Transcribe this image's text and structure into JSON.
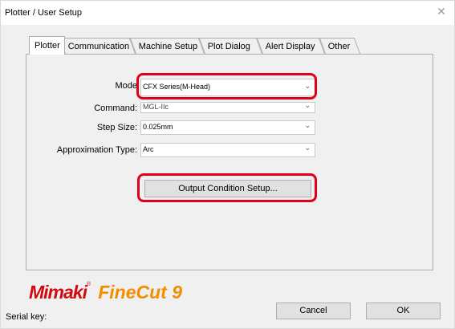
{
  "window": {
    "title": "Plotter / User Setup",
    "close_glyph": "✕"
  },
  "tabs": [
    {
      "label": "Plotter",
      "active": true
    },
    {
      "label": "Communication"
    },
    {
      "label": "Machine Setup"
    },
    {
      "label": "Plot Dialog"
    },
    {
      "label": "Alert Display"
    },
    {
      "label": "Other"
    }
  ],
  "form": {
    "mode": {
      "label": "Mode",
      "value": "CFX Series(M-Head)"
    },
    "command": {
      "label": "Command:",
      "value": "MGL-IIc"
    },
    "step_size": {
      "label": "Step Size:",
      "value": "0.025mm"
    },
    "approximation_type": {
      "label": "Approximation Type:",
      "value": "Arc"
    },
    "output_condition_button": "Output Condition Setup..."
  },
  "branding": {
    "mimaki": "Mimaki",
    "trademark": "®",
    "product": "FineCut 9"
  },
  "footer": {
    "serial_label": "Serial key:",
    "cancel": "Cancel",
    "ok": "OK"
  },
  "colors": {
    "highlight": "#e0001a",
    "mimaki_red": "#d10a11",
    "finecut_orange": "#f28c00"
  },
  "icons": {
    "dropdown": "chevron-down-icon",
    "close": "close-icon"
  }
}
